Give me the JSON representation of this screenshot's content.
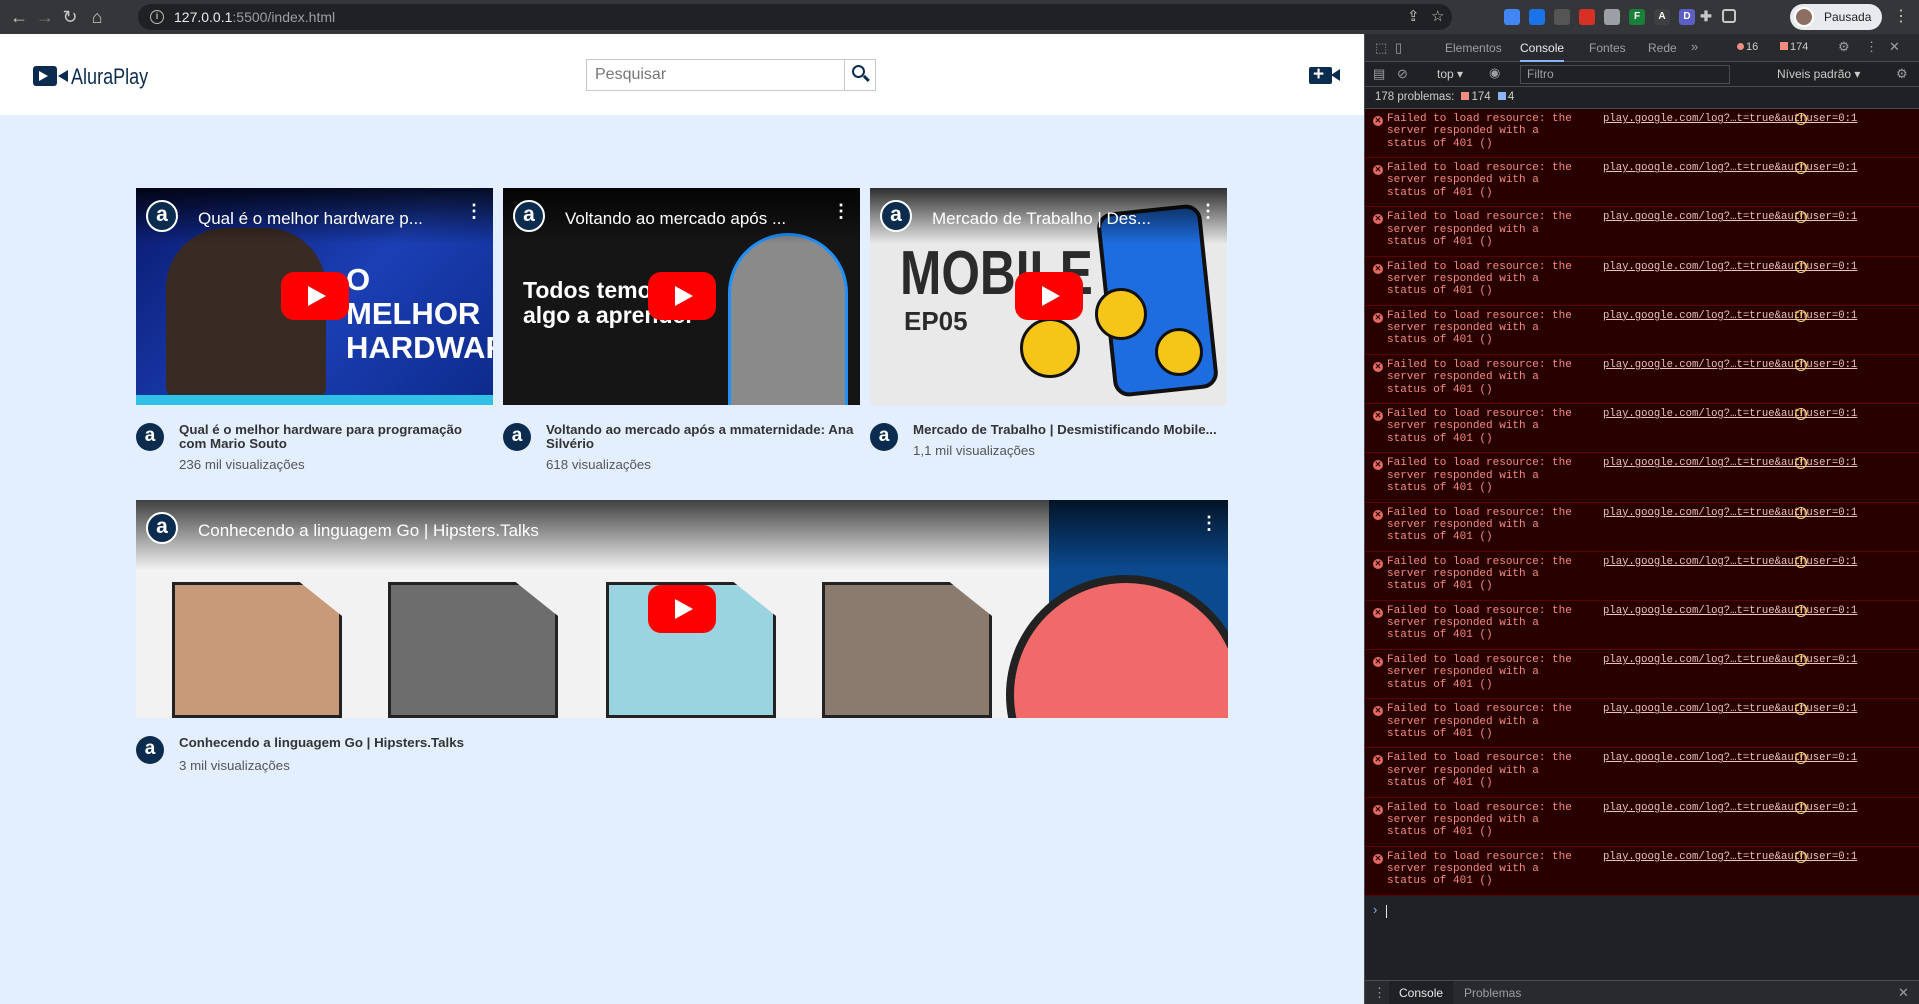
{
  "browser": {
    "url_host": "127.0.0.1",
    "url_path": ":5500/index.html",
    "profile_label": "Pausada",
    "extensions": [
      {
        "letter": "",
        "color": "#4285f4"
      },
      {
        "letter": "",
        "color": "#1a73e8"
      },
      {
        "letter": "",
        "color": "#555555"
      },
      {
        "letter": "",
        "color": "#d93025"
      },
      {
        "letter": "",
        "color": "#9aa0a6"
      },
      {
        "letter": "F",
        "color": "#188038"
      },
      {
        "letter": "A",
        "color": "#3c4043"
      },
      {
        "letter": "D",
        "color": "#5b5fc7"
      }
    ]
  },
  "site": {
    "brand": "AluraPlay",
    "search_placeholder": "Pesquisar",
    "videos": [
      {
        "title": "Qual é o melhor hardware p...",
        "full_title": "Qual é o melhor hardware para programação com Mario Souto",
        "views": "236 mil visualizações",
        "thumb_text": "O MELHOR HARDWARE",
        "channel_letter": "a"
      },
      {
        "title": "Voltando ao mercado após ...",
        "full_title": "Voltando ao mercado após a mmaternidade: Ana Silvério",
        "views": "618 visualizações",
        "thumb_text": "Todos temos algo a aprender",
        "channel_letter": "a"
      },
      {
        "title": "Mercado de Trabalho | Des...",
        "full_title": "Mercado de Trabalho | Desmistificando Mobile...",
        "views": "1,1 mil visualizações",
        "thumb_text": "MOBILE",
        "thumb_sub": "EP05",
        "channel_letter": "a"
      },
      {
        "title": "Conhecendo a linguagem Go | Hipsters.Talks",
        "full_title": "Conhecendo a linguagem Go | Hipsters.Talks",
        "views": "3 mil visualizações",
        "channel_letter": "a"
      }
    ]
  },
  "devtools": {
    "tabs": [
      "Elementos",
      "Console",
      "Fontes",
      "Rede"
    ],
    "active_tab": "Console",
    "error_count": "16",
    "issue_count": "174",
    "context": "top",
    "filter_placeholder": "Filtro",
    "levels": "Níveis padrão",
    "problems_label": "178 problemas:",
    "problems_red": "174",
    "problems_blue": "4",
    "message_text": "Failed to load resource: the server responded with a status of 401 ()",
    "message_link": "play.google.com/log?…t=true&authuser=0:1",
    "message_count": 16,
    "drawer_tabs": [
      "Console",
      "Problemas"
    ]
  },
  "colors": {
    "brand": "#0b2c4f",
    "page_bg": "#e3efff",
    "error_bg": "#290000",
    "error_text": "#f28b82"
  }
}
